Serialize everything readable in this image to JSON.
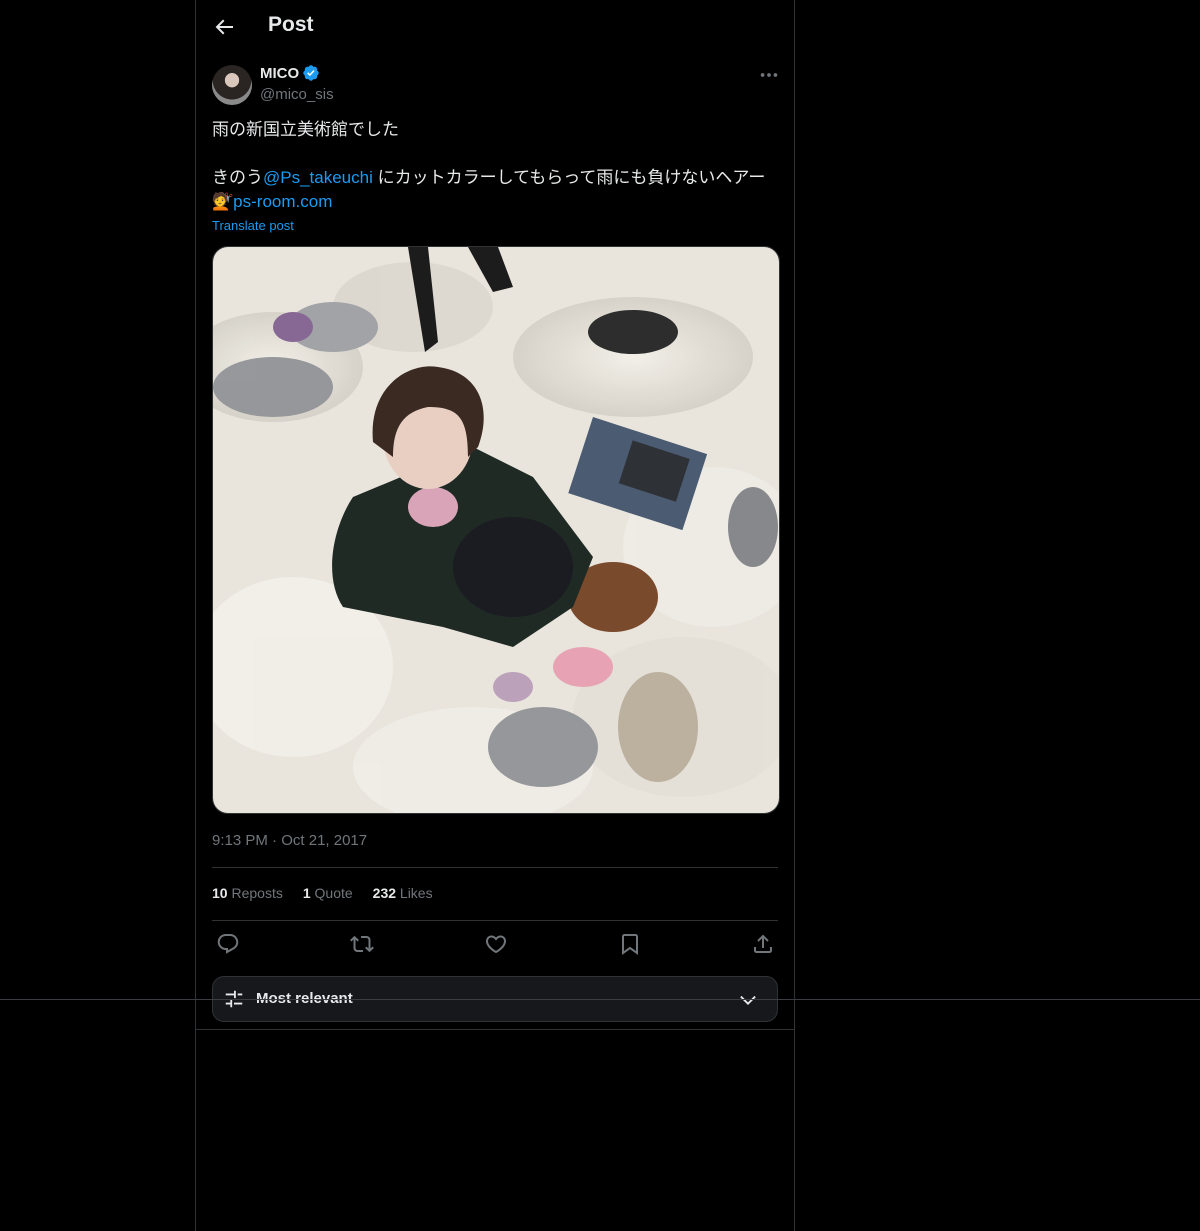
{
  "header": {
    "title": "Post"
  },
  "author": {
    "display_name": "MICO",
    "handle": "@mico_sis",
    "verified": true
  },
  "tweet": {
    "line1": "雨の新国立美術館でした",
    "line2_prefix": "きのう",
    "mention": "@Ps_takeuchi",
    "line2_suffix": " にカットカラーしてもらって雨にも負けないヘアー",
    "emoji": "💇",
    "url": "ps-room.com",
    "translate_label": "Translate post",
    "image_alt": "Image"
  },
  "meta": {
    "time": "9:13 PM",
    "separator": "·",
    "date": "Oct 21, 2017"
  },
  "stats": {
    "reposts_count": "10",
    "reposts_label": "Reposts",
    "quotes_count": "1",
    "quotes_label": "Quote",
    "likes_count": "232",
    "likes_label": "Likes"
  },
  "sort": {
    "label": "Most relevant"
  },
  "colors": {
    "accent": "#1d9bf0",
    "muted": "#71767b",
    "border": "#2f3336",
    "background": "#000000"
  }
}
